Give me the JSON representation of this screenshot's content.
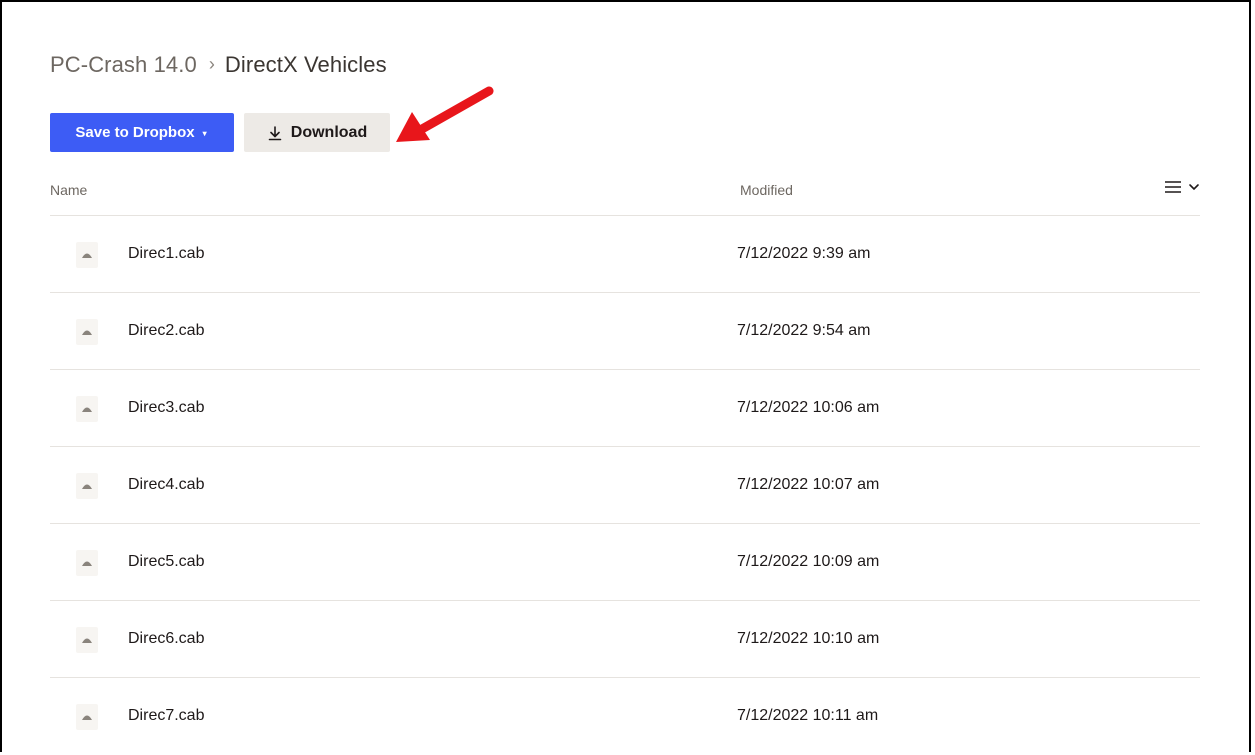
{
  "breadcrumb": {
    "parent": "PC-Crash 14.0",
    "separator": "›",
    "current": "DirectX Vehicles"
  },
  "toolbar": {
    "save_label": "Save to Dropbox",
    "save_caret": "▾",
    "download_label": "Download"
  },
  "colors": {
    "primary": "#3d5cf5",
    "secondary_button": "#edeae6",
    "arrow": "#e8161b"
  },
  "table": {
    "headers": {
      "name": "Name",
      "modified": "Modified"
    },
    "rows": [
      {
        "name": "Direc1.cab",
        "modified": "7/12/2022 9:39 am",
        "icon": "file-icon"
      },
      {
        "name": "Direc2.cab",
        "modified": "7/12/2022 9:54 am",
        "icon": "file-icon"
      },
      {
        "name": "Direc3.cab",
        "modified": "7/12/2022 10:06 am",
        "icon": "file-icon"
      },
      {
        "name": "Direc4.cab",
        "modified": "7/12/2022 10:07 am",
        "icon": "file-icon"
      },
      {
        "name": "Direc5.cab",
        "modified": "7/12/2022 10:09 am",
        "icon": "file-icon"
      },
      {
        "name": "Direc6.cab",
        "modified": "7/12/2022 10:10 am",
        "icon": "file-icon"
      },
      {
        "name": "Direc7.cab",
        "modified": "7/12/2022 10:11 am",
        "icon": "file-icon"
      }
    ]
  }
}
